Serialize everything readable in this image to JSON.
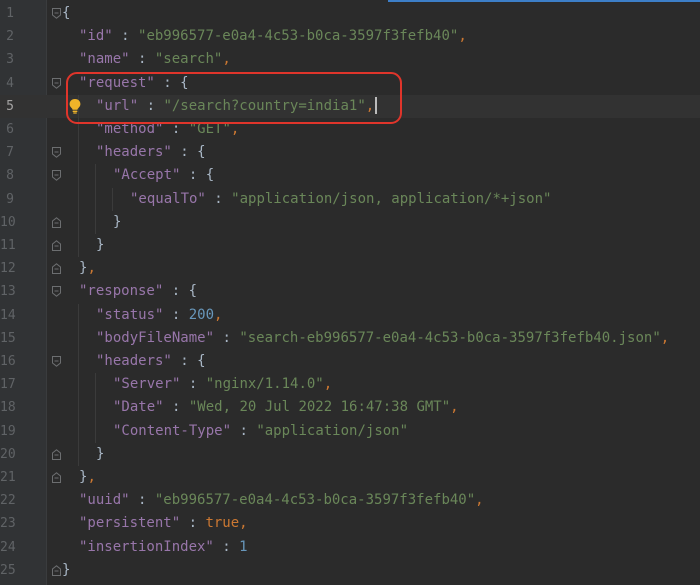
{
  "editor": {
    "current_line": 5,
    "lines": [
      {
        "n": "1",
        "indent": 0,
        "tokens": [
          [
            "p",
            "{"
          ]
        ]
      },
      {
        "n": "2",
        "indent": 1,
        "tokens": [
          [
            "k",
            "\"id\""
          ],
          [
            "p",
            " : "
          ],
          [
            "s",
            "\"eb996577-e0a4-4c53-b0ca-3597f3fefb40\""
          ],
          [
            "c",
            ","
          ]
        ]
      },
      {
        "n": "3",
        "indent": 1,
        "tokens": [
          [
            "k",
            "\"name\""
          ],
          [
            "p",
            " : "
          ],
          [
            "s",
            "\"search\""
          ],
          [
            "c",
            ","
          ]
        ]
      },
      {
        "n": "4",
        "indent": 1,
        "tokens": [
          [
            "k",
            "\"request\""
          ],
          [
            "p",
            " : {"
          ]
        ]
      },
      {
        "n": "5",
        "indent": 2,
        "tokens": [
          [
            "k",
            "\"url\""
          ],
          [
            "p",
            " : "
          ],
          [
            "s",
            "\"/search?country=india1\""
          ],
          [
            "c",
            ","
          ]
        ]
      },
      {
        "n": "6",
        "indent": 2,
        "tokens": [
          [
            "k",
            "\"method\""
          ],
          [
            "p",
            " : "
          ],
          [
            "s",
            "\"GET\""
          ],
          [
            "c",
            ","
          ]
        ]
      },
      {
        "n": "7",
        "indent": 2,
        "tokens": [
          [
            "k",
            "\"headers\""
          ],
          [
            "p",
            " : {"
          ]
        ]
      },
      {
        "n": "8",
        "indent": 3,
        "tokens": [
          [
            "k",
            "\"Accept\""
          ],
          [
            "p",
            " : {"
          ]
        ]
      },
      {
        "n": "9",
        "indent": 4,
        "tokens": [
          [
            "k",
            "\"equalTo\""
          ],
          [
            "p",
            " : "
          ],
          [
            "s",
            "\"application/json, application/*+json\""
          ]
        ]
      },
      {
        "n": "10",
        "indent": 3,
        "tokens": [
          [
            "p",
            "}"
          ]
        ]
      },
      {
        "n": "11",
        "indent": 2,
        "tokens": [
          [
            "p",
            "}"
          ]
        ]
      },
      {
        "n": "12",
        "indent": 1,
        "tokens": [
          [
            "p",
            "}"
          ],
          [
            "c",
            ","
          ]
        ]
      },
      {
        "n": "13",
        "indent": 1,
        "tokens": [
          [
            "k",
            "\"response\""
          ],
          [
            "p",
            " : {"
          ]
        ]
      },
      {
        "n": "14",
        "indent": 2,
        "tokens": [
          [
            "k",
            "\"status\""
          ],
          [
            "p",
            " : "
          ],
          [
            "n",
            "200"
          ],
          [
            "c",
            ","
          ]
        ]
      },
      {
        "n": "15",
        "indent": 2,
        "tokens": [
          [
            "k",
            "\"bodyFileName\""
          ],
          [
            "p",
            " : "
          ],
          [
            "s",
            "\"search-eb996577-e0a4-4c53-b0ca-3597f3fefb40.json\""
          ],
          [
            "c",
            ","
          ]
        ]
      },
      {
        "n": "16",
        "indent": 2,
        "tokens": [
          [
            "k",
            "\"headers\""
          ],
          [
            "p",
            " : {"
          ]
        ]
      },
      {
        "n": "17",
        "indent": 3,
        "tokens": [
          [
            "k",
            "\"Server\""
          ],
          [
            "p",
            " : "
          ],
          [
            "s",
            "\"nginx/1.14.0\""
          ],
          [
            "c",
            ","
          ]
        ]
      },
      {
        "n": "18",
        "indent": 3,
        "tokens": [
          [
            "k",
            "\"Date\""
          ],
          [
            "p",
            " : "
          ],
          [
            "s",
            "\"Wed, 20 Jul 2022 16:47:38 GMT\""
          ],
          [
            "c",
            ","
          ]
        ]
      },
      {
        "n": "19",
        "indent": 3,
        "tokens": [
          [
            "k",
            "\"Content-Type\""
          ],
          [
            "p",
            " : "
          ],
          [
            "s",
            "\"application/json\""
          ]
        ]
      },
      {
        "n": "20",
        "indent": 2,
        "tokens": [
          [
            "p",
            "}"
          ]
        ]
      },
      {
        "n": "21",
        "indent": 1,
        "tokens": [
          [
            "p",
            "}"
          ],
          [
            "c",
            ","
          ]
        ]
      },
      {
        "n": "22",
        "indent": 1,
        "tokens": [
          [
            "k",
            "\"uuid\""
          ],
          [
            "p",
            " : "
          ],
          [
            "s",
            "\"eb996577-e0a4-4c53-b0ca-3597f3fefb40\""
          ],
          [
            "c",
            ","
          ]
        ]
      },
      {
        "n": "23",
        "indent": 1,
        "tokens": [
          [
            "k",
            "\"persistent\""
          ],
          [
            "p",
            " : "
          ],
          [
            "b",
            "true"
          ],
          [
            "c",
            ","
          ]
        ]
      },
      {
        "n": "24",
        "indent": 1,
        "tokens": [
          [
            "k",
            "\"insertionIndex\""
          ],
          [
            "p",
            " : "
          ],
          [
            "n",
            "1"
          ]
        ]
      },
      {
        "n": "25",
        "indent": 0,
        "tokens": [
          [
            "p",
            "}"
          ]
        ]
      }
    ],
    "fold_open_lines": [
      1,
      4,
      7,
      8,
      13,
      16
    ],
    "fold_close_lines": [
      10,
      11,
      12,
      20,
      21,
      25
    ],
    "bulb_line": 5,
    "highlighted_lines": [
      4,
      5
    ]
  },
  "colors": {
    "background": "#2b2b2b",
    "gutter": "#313335",
    "key": "#9876aa",
    "string": "#6a8759",
    "number": "#6897bb",
    "keyword": "#cc7832",
    "highlight_box": "#e0352b"
  },
  "icons": {
    "intention_bulb": "lightbulb-icon",
    "fold_marker": "fold-marker-icon"
  }
}
